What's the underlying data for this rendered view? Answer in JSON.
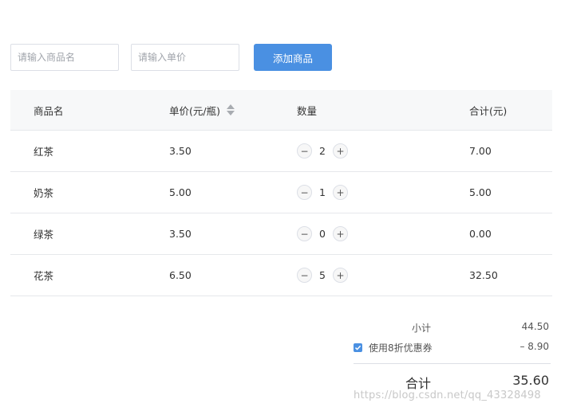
{
  "form": {
    "name_placeholder": "请输入商品名",
    "price_placeholder": "请输入单价",
    "add_button_label": "添加商品"
  },
  "table": {
    "headers": {
      "name": "商品名",
      "price": "单价(元/瓶)",
      "quantity": "数量",
      "subtotal": "合计(元)"
    },
    "rows": [
      {
        "name": "红茶",
        "price": "3.50",
        "quantity": "2",
        "subtotal": "7.00"
      },
      {
        "name": "奶茶",
        "price": "5.00",
        "quantity": "1",
        "subtotal": "5.00"
      },
      {
        "name": "绿茶",
        "price": "3.50",
        "quantity": "0",
        "subtotal": "0.00"
      },
      {
        "name": "花茶",
        "price": "6.50",
        "quantity": "5",
        "subtotal": "32.50"
      }
    ],
    "decrement_symbol": "−",
    "increment_symbol": "+"
  },
  "summary": {
    "subtotal_label": "小计",
    "subtotal_value": "44.50",
    "coupon_checked": true,
    "coupon_label": "使用8折优惠券",
    "coupon_value": "– 8.90",
    "total_label": "合计",
    "total_value": "35.60"
  },
  "watermark": "https://blog.csdn.net/qq_43328498",
  "colors": {
    "accent": "#4a90e2",
    "header_bg": "#f7f8f9",
    "border": "#e6e8eb"
  }
}
